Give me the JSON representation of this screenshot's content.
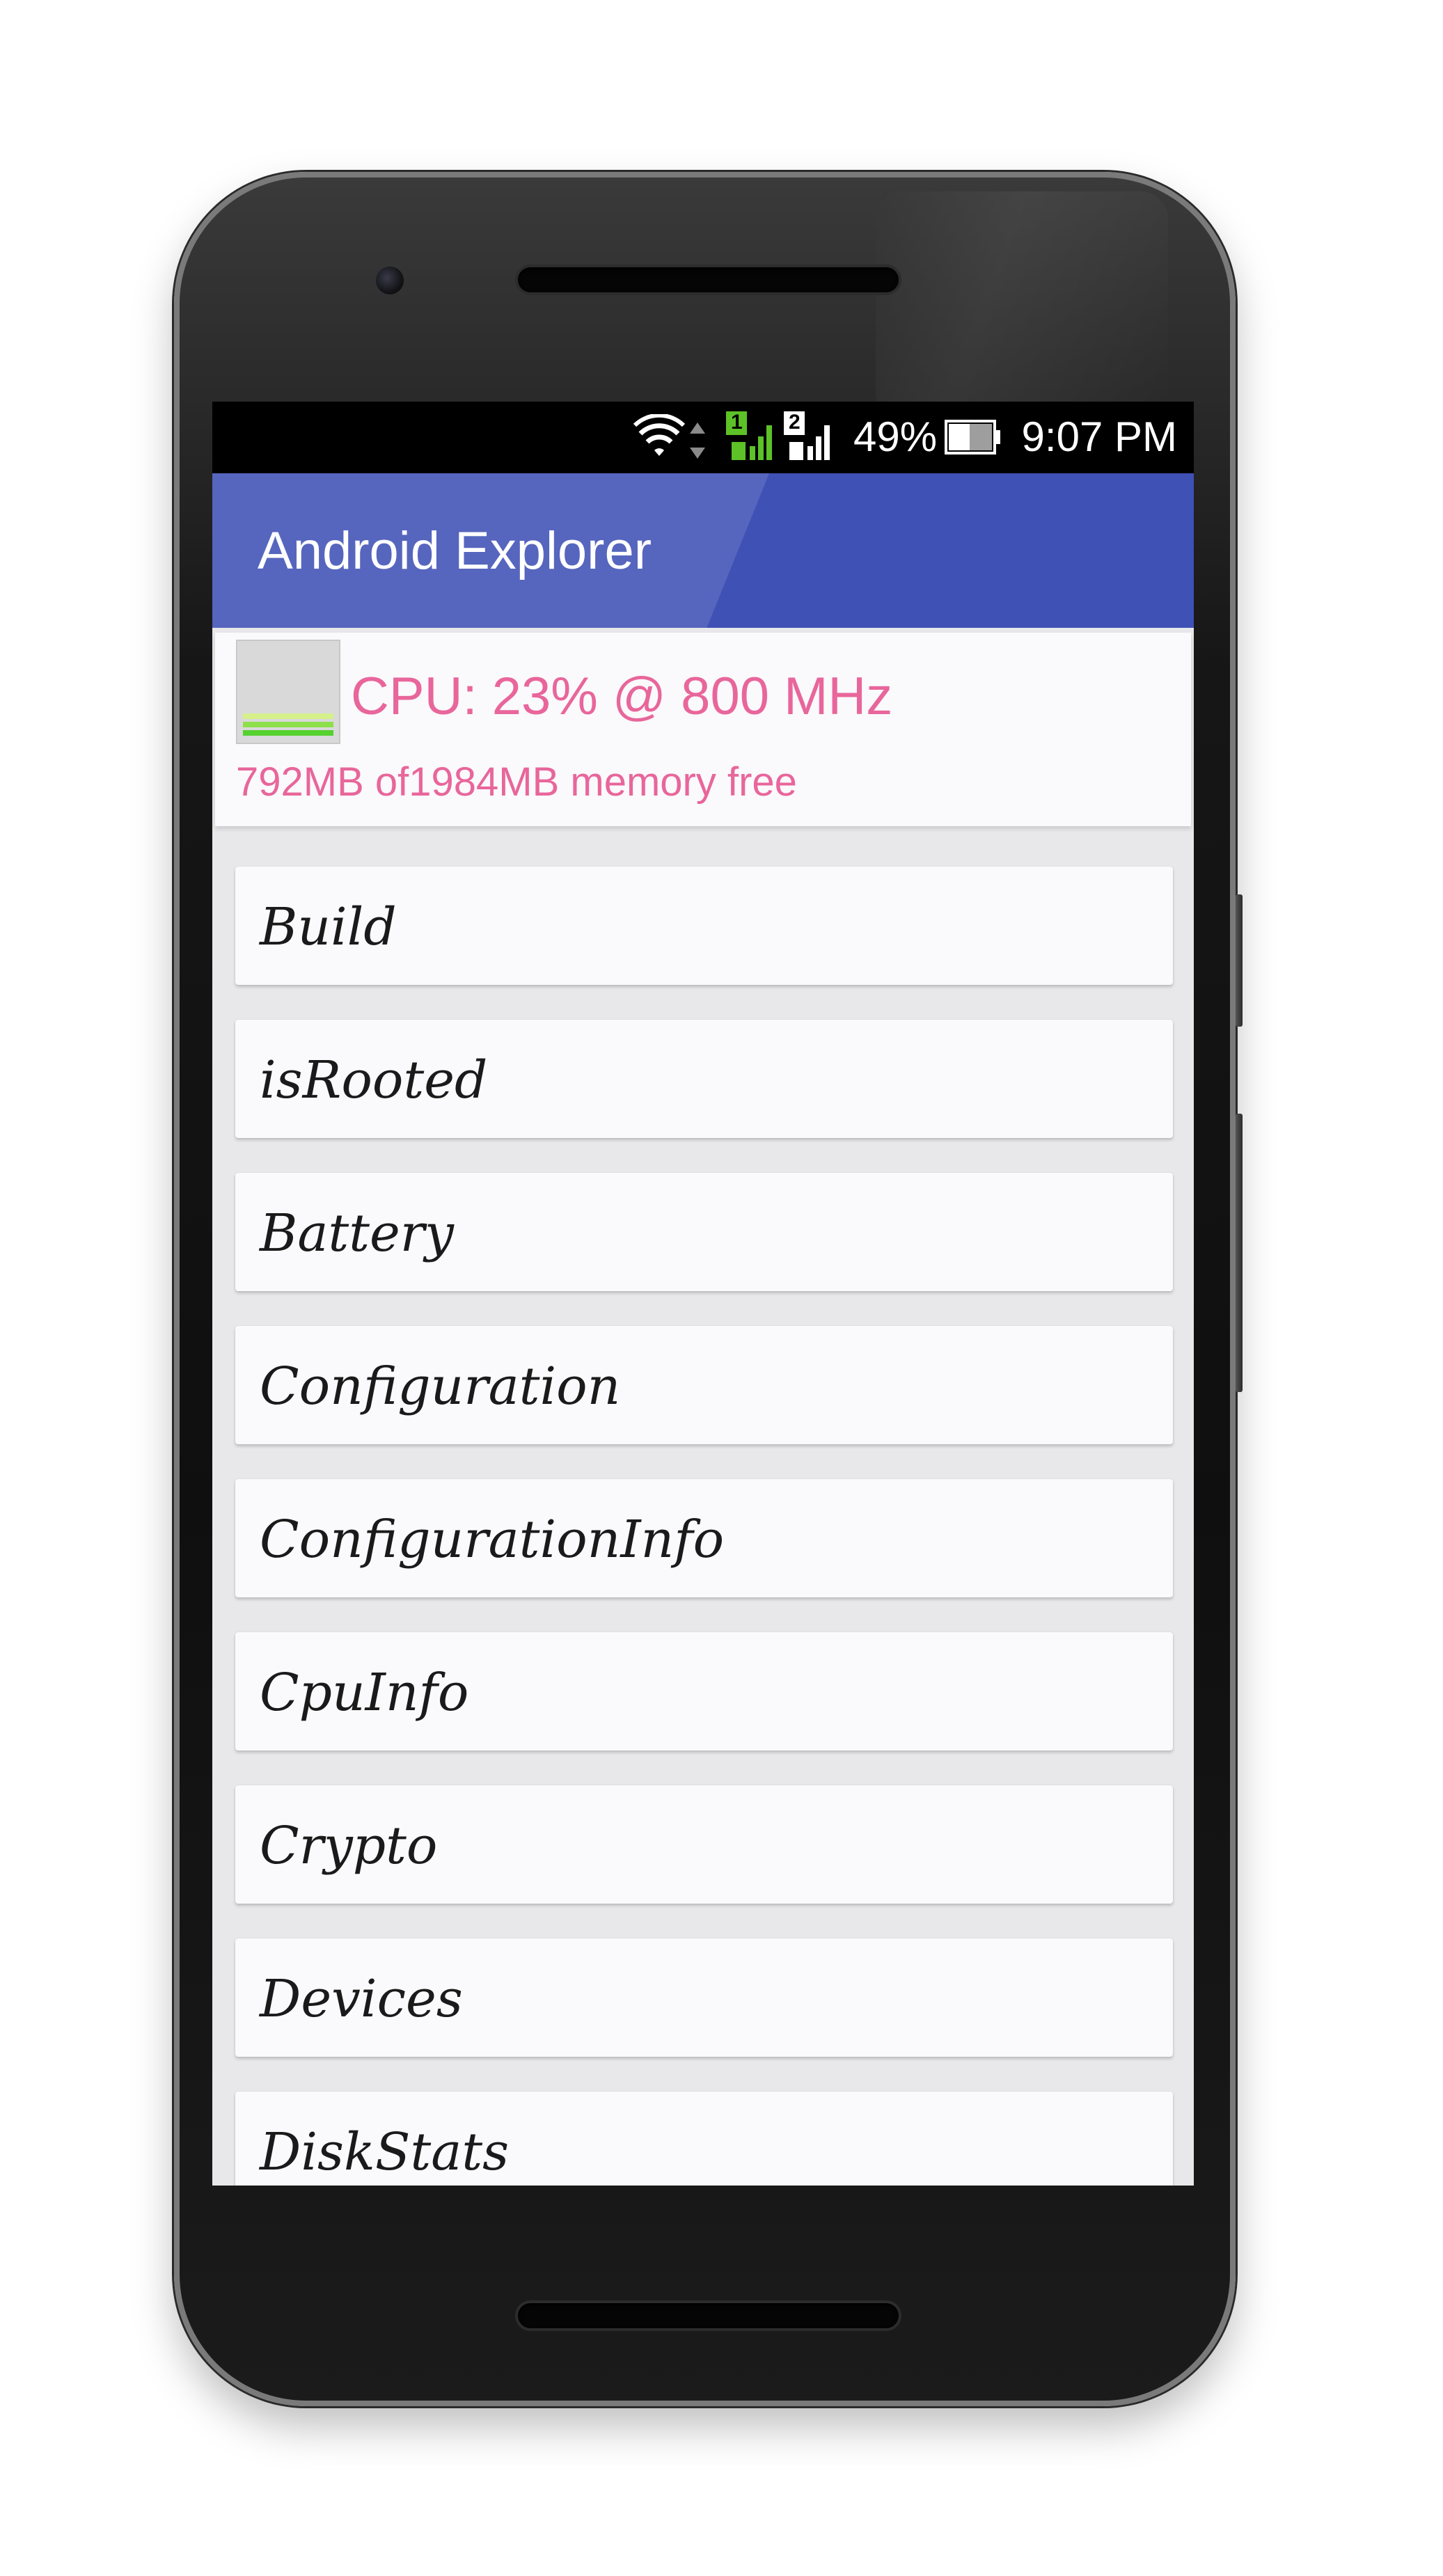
{
  "status_bar": {
    "icons": [
      "wifi-icon",
      "data-arrows-icon",
      "sim1-signal-icon",
      "sim2-signal-icon",
      "battery-icon"
    ],
    "sim1_label": "1",
    "sim2_label": "2",
    "battery_percent": "49%",
    "battery_level": 0.49,
    "time": "9:07 PM"
  },
  "app_bar": {
    "title": "Android Explorer",
    "color": "#3f51b5"
  },
  "info_card": {
    "cpu_text": "CPU: 23% @ 800 MHz",
    "memory_text": "792MB of1984MB memory free",
    "text_color": "#e8669b"
  },
  "list": {
    "items": [
      {
        "label": "Build"
      },
      {
        "label": "isRooted"
      },
      {
        "label": "Battery"
      },
      {
        "label": "Configuration"
      },
      {
        "label": "ConfigurationInfo"
      },
      {
        "label": "CpuInfo"
      },
      {
        "label": "Crypto"
      },
      {
        "label": "Devices"
      },
      {
        "label": "DiskStats"
      }
    ]
  }
}
